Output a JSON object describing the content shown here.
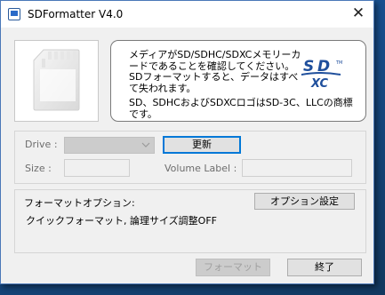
{
  "window": {
    "title": "SDFormatter V4.0",
    "close_glyph": "✕"
  },
  "info": {
    "message": "メディアがSD/SDHC/SDXCメモリーカードであることを確認してください。SDフォーマットすると、データはすべて失われます。",
    "trademark": "SD、SDHCおよびSDXCロゴはSD-3C、LLCの商標です。",
    "logo_text": "SD XC",
    "logo_color": "#1f4f9c"
  },
  "drive": {
    "drive_label": "Drive :",
    "drive_value": "",
    "refresh_label": "更新",
    "size_label": "Size :",
    "size_value": "",
    "volume_label": "Volume Label :",
    "volume_value": ""
  },
  "options": {
    "title": "フォーマットオプション:",
    "settings_button": "オプション設定",
    "summary": "クイックフォーマット, 論理サイズ調整OFF"
  },
  "footer": {
    "format_button": "フォーマット",
    "exit_button": "終了"
  }
}
